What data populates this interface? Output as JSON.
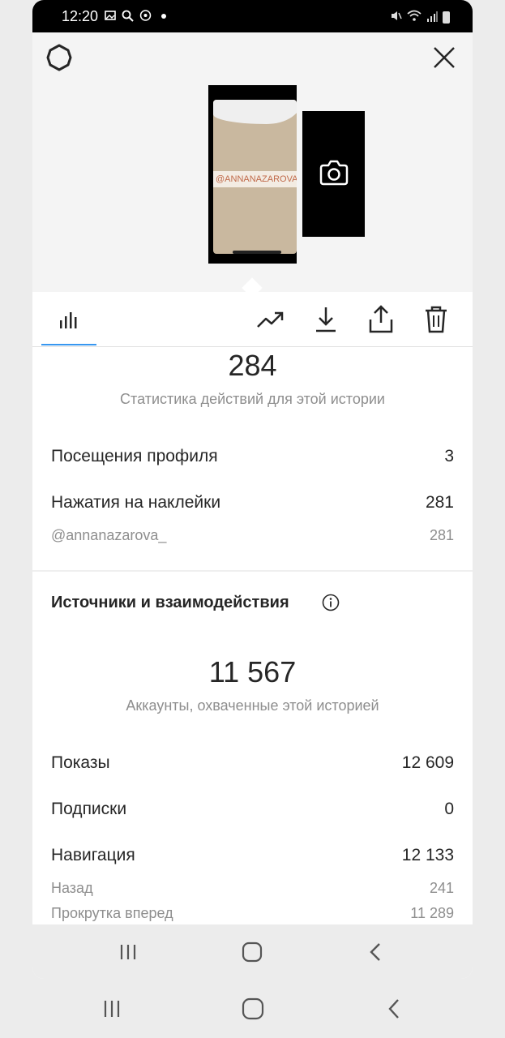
{
  "status_bar": {
    "time": "12:20",
    "left_icons": [
      "image-icon",
      "search-icon",
      "viber-icon",
      "dot-icon"
    ],
    "right_icons": [
      "mute-icon",
      "wifi-icon",
      "signal-icon",
      "battery-icon"
    ]
  },
  "header": {
    "settings_icon": "gear-icon",
    "close_icon": "close-icon",
    "story_sticker_text": "@ANNANAZAROVA_",
    "camera_icon": "camera-icon"
  },
  "tabs": [
    {
      "icon": "insights-bars-icon",
      "active": true
    },
    {
      "icon": "trend-up-icon"
    },
    {
      "icon": "download-icon"
    },
    {
      "icon": "share-icon"
    },
    {
      "icon": "trash-icon"
    }
  ],
  "interactions": {
    "total": "284",
    "caption": "Статистика действий для этой истории",
    "rows": [
      {
        "label": "Посещения профиля",
        "value": "3"
      },
      {
        "label": "Нажатия на наклейки",
        "value": "281"
      }
    ],
    "sub_rows": [
      {
        "label": "@annanazarova_",
        "value": "281"
      }
    ]
  },
  "discovery": {
    "title": "Источники и взаимодействия",
    "info_icon": "info-icon",
    "total": "11 567",
    "caption": "Аккаунты, охваченные этой историей",
    "rows": [
      {
        "label": "Показы",
        "value": "12 609"
      },
      {
        "label": "Подписки",
        "value": "0"
      },
      {
        "label": "Навигация",
        "value": "12 133"
      }
    ],
    "sub_rows": [
      {
        "label": "Назад",
        "value": "241"
      },
      {
        "label": "Прокрутка вперед",
        "value": "11 289"
      }
    ]
  },
  "system_nav": {
    "buttons": [
      "recents-icon",
      "home-icon",
      "back-icon"
    ]
  },
  "colors": {
    "accent": "#3897f0",
    "text_primary": "#262626",
    "text_secondary": "#8e8e8e"
  }
}
